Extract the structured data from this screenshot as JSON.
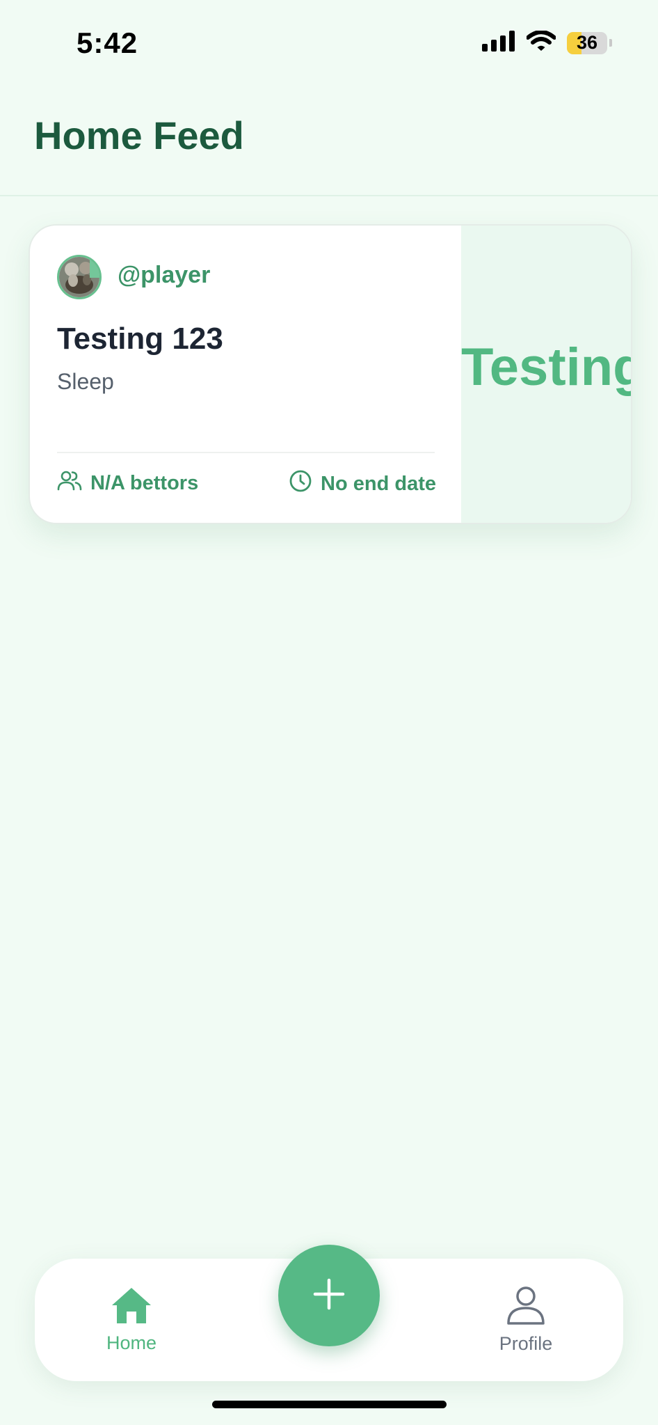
{
  "status_bar": {
    "time": "5:42",
    "battery_level": "36",
    "battery_fraction": 0.36,
    "battery_color": "#f6cf3e"
  },
  "header": {
    "title": "Home Feed"
  },
  "feed": {
    "cards": [
      {
        "username": "@player",
        "title": "Testing 123",
        "category": "Sleep",
        "bettors": "N/A bettors",
        "end_date": "No end date",
        "side_text": "Testing",
        "icons": {
          "bettors": "users-icon",
          "end_date": "clock-icon"
        }
      }
    ]
  },
  "bottom_nav": {
    "home_label": "Home",
    "profile_label": "Profile",
    "home_icon": "home-icon",
    "profile_icon": "person-icon",
    "add_icon": "plus-icon",
    "active_tab": "Home"
  },
  "colors": {
    "background": "#f1fbf4",
    "accent": "#56b986",
    "title": "#1c5a3e",
    "meta_text": "#3c9468"
  }
}
